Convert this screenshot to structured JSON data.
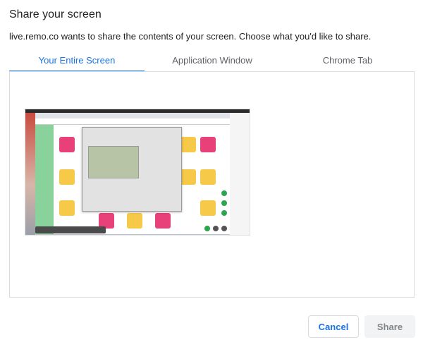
{
  "dialog": {
    "title": "Share your screen",
    "subtitle": "live.remo.co wants to share the contents of your screen. Choose what you'd like to share."
  },
  "tabs": [
    {
      "label": "Your Entire Screen",
      "active": true
    },
    {
      "label": "Application Window",
      "active": false
    },
    {
      "label": "Chrome Tab",
      "active": false
    }
  ],
  "buttons": {
    "cancel_label": "Cancel",
    "share_label": "Share"
  },
  "colors": {
    "accent": "#1a73e8",
    "border": "#dadce0",
    "disabled_bg": "#f1f3f4",
    "disabled_text": "#80868b"
  }
}
